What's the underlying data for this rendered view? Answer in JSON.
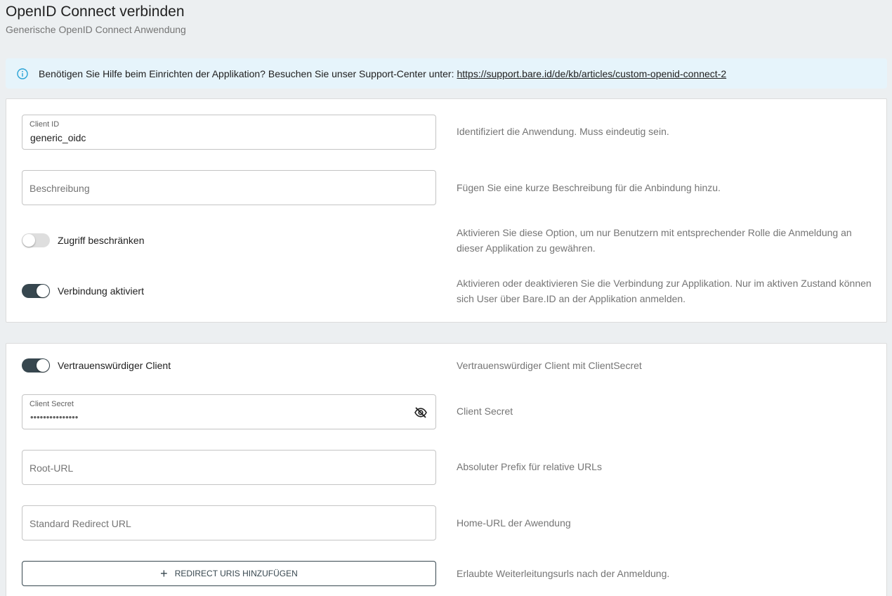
{
  "header": {
    "title": "OpenID Connect verbinden",
    "subtitle": "Generische OpenID Connect Anwendung"
  },
  "info": {
    "text": "Benötigen Sie Hilfe beim Einrichten der Applikation? Besuchen Sie unser Support-Center unter:",
    "link": "https://support.bare.id/de/kb/articles/custom-openid-connect-2",
    "icon": "info-icon"
  },
  "card1": {
    "client_id": {
      "label": "Client ID",
      "value": "generic_oidc",
      "help": "Identifiziert die Anwendung. Muss eindeutig sein."
    },
    "description": {
      "placeholder": "Beschreibung",
      "help": "Fügen Sie eine kurze Beschreibung für die Anbindung hinzu."
    },
    "restrict_access": {
      "label": "Zugriff beschränken",
      "enabled": false,
      "help": "Aktivieren Sie diese Option, um nur Benutzern mit entsprechender Rolle die Anmeldung an dieser Applikation zu gewähren."
    },
    "connection_active": {
      "label": "Verbindung aktiviert",
      "enabled": true,
      "help": "Aktivieren oder deaktivieren Sie die Verbindung zur Applikation. Nur im aktiven Zustand können sich User über Bare.ID an der Applikation anmelden."
    }
  },
  "card2": {
    "trusted_client": {
      "label": "Vertrauenswürdiger Client",
      "enabled": true,
      "help": "Vertrauenswürdiger Client mit ClientSecret"
    },
    "client_secret": {
      "label": "Client Secret",
      "value": "•••••••••••••••",
      "help": "Client Secret",
      "icon": "eye-off-icon"
    },
    "root_url": {
      "placeholder": "Root-URL",
      "help": "Absoluter Prefix für relative URLs"
    },
    "redirect_url": {
      "placeholder": "Standard Redirect URL",
      "help": "Home-URL der Awendung"
    },
    "redirect_uris": {
      "button_label": "REDIRECT URIS HINZUFÜGEN",
      "help": "Erlaubte Weiterleitungsurls nach der Anmeldung."
    }
  },
  "colors": {
    "accent": "#37474f",
    "info_bg": "#e6f4fb",
    "info_icon": "#29a3d6",
    "page_bg": "#eceff1"
  }
}
